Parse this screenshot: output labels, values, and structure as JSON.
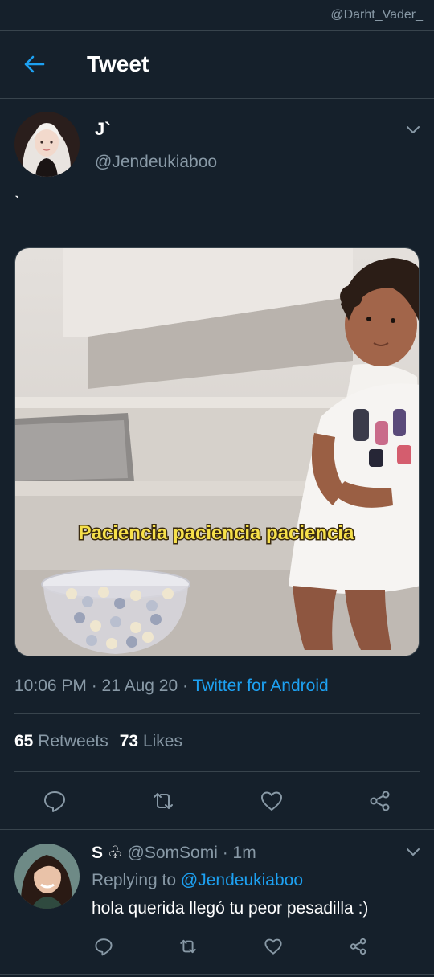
{
  "watermark": "@Darht_Vader_",
  "header": {
    "title": "Tweet"
  },
  "tweet": {
    "name": "J`",
    "handle": "@Jendeukiaboo",
    "text": "`",
    "media_caption": "Paciencia paciencia paciencia",
    "time": "10:06 PM · 21 Aug 20 · ",
    "source": "Twitter for Android",
    "retweets_count": "65",
    "retweets_label": "Retweets",
    "likes_count": "73",
    "likes_label": "Likes"
  },
  "reply": {
    "name": "S ♧",
    "handle": "@SomSomi",
    "age": "1m",
    "replying_prefix": "Replying to ",
    "replying_to": "@Jendeukiaboo",
    "text": "hola querida llegó tu peor pesadilla :)"
  },
  "colors": {
    "background": "#15202b",
    "accent": "#1da1f2",
    "muted": "#8899a6",
    "divider": "#38444d"
  }
}
